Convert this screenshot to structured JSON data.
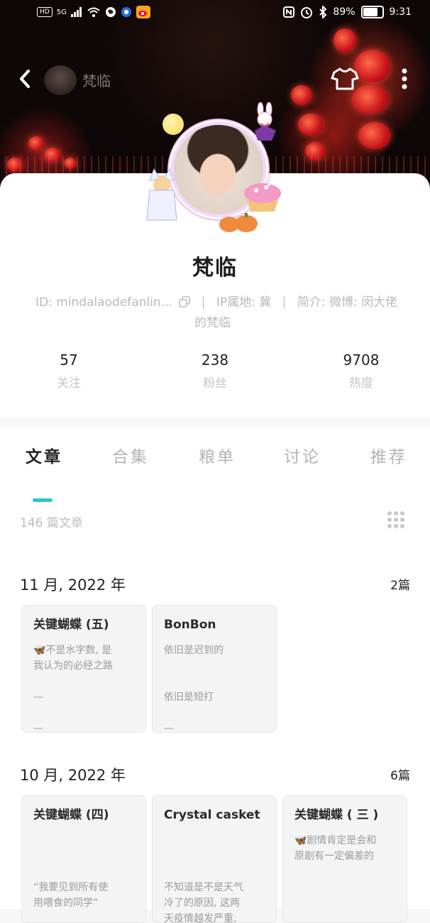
{
  "status_bar": {
    "left_chips": [
      "HD",
      "5G"
    ],
    "battery": "89%",
    "battery_level": 0.89,
    "time": "9:31"
  },
  "top_nav": {
    "name": "梵临",
    "icons": [
      "back-icon",
      "shirt-icon",
      "more-icon"
    ]
  },
  "profile": {
    "username": "梵临",
    "id_text": "ID: mindalaodefanlin...",
    "ip_text": "IP属地: 冀",
    "intro_text": "简介: 微博: 闵大佬",
    "intro_text_2": "的梵临"
  },
  "stats": [
    {
      "value": "57",
      "label": "关注"
    },
    {
      "value": "238",
      "label": "粉丝"
    },
    {
      "value": "9708",
      "label": "热度"
    }
  ],
  "tabs": [
    "文章",
    "合集",
    "粮单",
    "讨论",
    "推荐"
  ],
  "active_tab": "文章",
  "article_count": "146 篇文章",
  "months": [
    {
      "title": "11 月, 2022 年",
      "count": "2篇",
      "articles": [
        {
          "title": "关键蝴蝶 (五)",
          "lines": [
            "🦋不是水字数, 是",
            "我认为的必经之路",
            "",
            "—",
            "",
            "—"
          ]
        },
        {
          "title": "BonBon",
          "lines": [
            "依旧是迟到的",
            "",
            "",
            "依旧是短打",
            "",
            "—"
          ]
        }
      ]
    },
    {
      "title": "10 月, 2022 年",
      "count": "6篇",
      "articles": [
        {
          "title": "关键蝴蝶 (四)",
          "lines": [
            "",
            "",
            "",
            "“我要见到所有使",
            "用喂食的同学”"
          ]
        },
        {
          "title": "Crystal casket",
          "lines": [
            "",
            "",
            "",
            "不知道是不是天气",
            "冷了的原因, 这两",
            "天疫情越发严重,"
          ]
        },
        {
          "title": "关键蝴蝶 ( 三 )",
          "lines": [
            "🦋剧情肯定是会和",
            "原剧有一定偏差的"
          ]
        }
      ]
    }
  ]
}
